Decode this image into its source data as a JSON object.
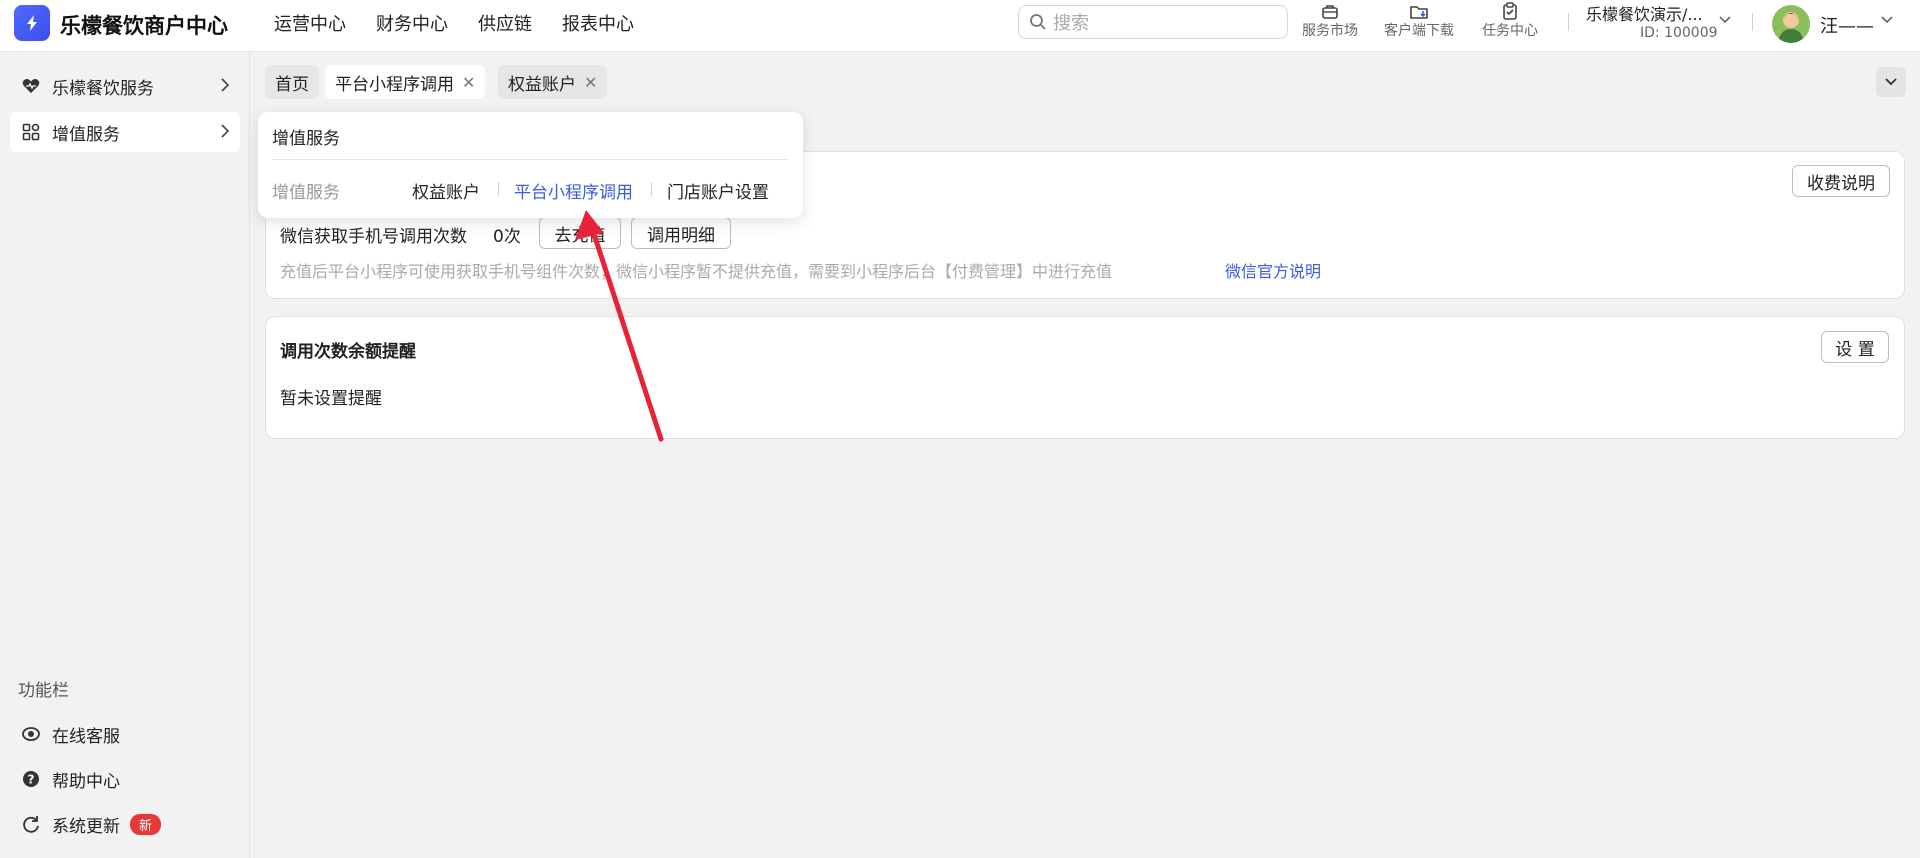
{
  "header": {
    "app_title": "乐檬餐饮商户中心",
    "nav": [
      "运营中心",
      "财务中心",
      "供应链",
      "报表中心"
    ],
    "search_placeholder": "搜索",
    "tools": [
      {
        "label": "服务市场",
        "icon": "briefcase-icon"
      },
      {
        "label": "客户端下载",
        "icon": "folder-download-icon"
      },
      {
        "label": "任务中心",
        "icon": "clipboard-check-icon"
      }
    ],
    "shop_name": "乐檬餐饮演示/...",
    "shop_id": "ID: 100009",
    "user_name": "汪——"
  },
  "sidebar": {
    "items": [
      {
        "label": "乐檬餐饮服务",
        "icon": "heart-icon"
      },
      {
        "label": "增值服务",
        "icon": "grid-icon"
      }
    ],
    "function_title": "功能栏",
    "function_items": [
      {
        "label": "在线客服",
        "icon": "headset-icon"
      },
      {
        "label": "帮助中心",
        "icon": "help-icon"
      },
      {
        "label": "系统更新",
        "icon": "refresh-icon",
        "badge": "新"
      }
    ]
  },
  "tabs": [
    {
      "label": "首页",
      "closable": false
    },
    {
      "label": "平台小程序调用",
      "closable": true
    },
    {
      "label": "权益账户",
      "closable": true
    }
  ],
  "menu_panel": {
    "title": "增值服务",
    "group": "增值服务",
    "links": [
      "权益账户",
      "平台小程序调用",
      "门店账户设置"
    ],
    "active_link": "平台小程序调用"
  },
  "usage_card": {
    "fee_button": "收费说明",
    "metric_label": "微信获取手机号调用次数",
    "metric_value": "0次",
    "recharge_button": "去充值",
    "detail_button": "调用明细",
    "note": "充值后平台小程序可使用获取手机号组件次数；微信小程序暂不提供充值，需要到小程序后台【付费管理】中进行充值",
    "note_link": "微信官方说明"
  },
  "reminder_card": {
    "title": "调用次数余额提醒",
    "setting_button": "设 置",
    "status": "暂未设置提醒"
  },
  "colors": {
    "accent": "#3a5ce8",
    "arrow": "#e8223a",
    "badge": "#e53935"
  }
}
